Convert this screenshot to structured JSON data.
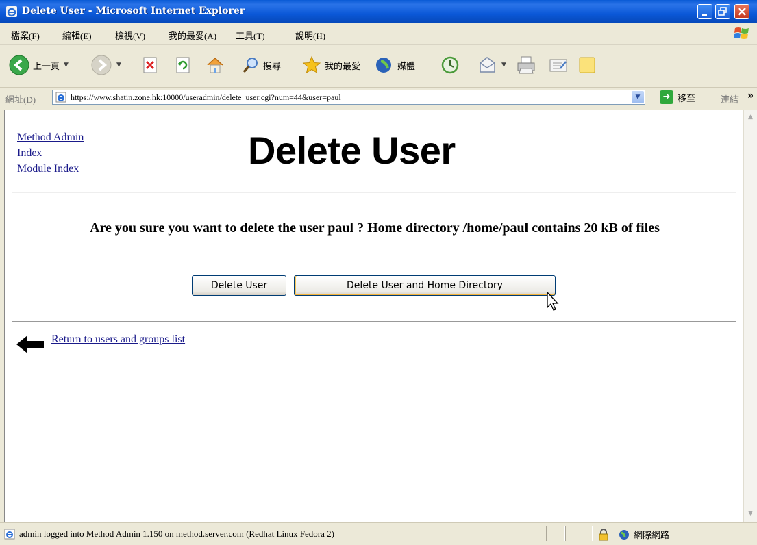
{
  "window": {
    "title": "Delete User - Microsoft Internet Explorer"
  },
  "menu": {
    "items": [
      "檔案(F)",
      "編輯(E)",
      "檢視(V)",
      "我的最愛(A)",
      "工具(T)",
      "說明(H)"
    ]
  },
  "toolbar": {
    "back_label": "上一頁",
    "search_label": "搜尋",
    "favorites_label": "我的最愛",
    "media_label": "媒體"
  },
  "address": {
    "label": "網址(D)",
    "url": "https://www.shatin.zone.hk:10000/useradmin/delete_user.cgi?num=44&user=paul",
    "go_label": "移至",
    "links_label": "連結",
    "more": "»"
  },
  "page": {
    "nav_links": [
      "Method Admin",
      "Index",
      "Module Index"
    ],
    "title": "Delete User",
    "question": "Are you sure you want to delete the user paul ? Home directory /home/paul contains 20 kB of files",
    "buttons": {
      "delete_user": "Delete User",
      "delete_user_home": "Delete User and Home Directory"
    },
    "return_link": "Return to users and groups list"
  },
  "status": {
    "text": "admin logged into Method Admin 1.150 on method.server.com (Redhat Linux Fedora 2)",
    "zone": "網際網路"
  },
  "colors": {
    "titlebar": "#0a5bd6",
    "link": "#1a1a8a",
    "chrome": "#ece9d8"
  }
}
